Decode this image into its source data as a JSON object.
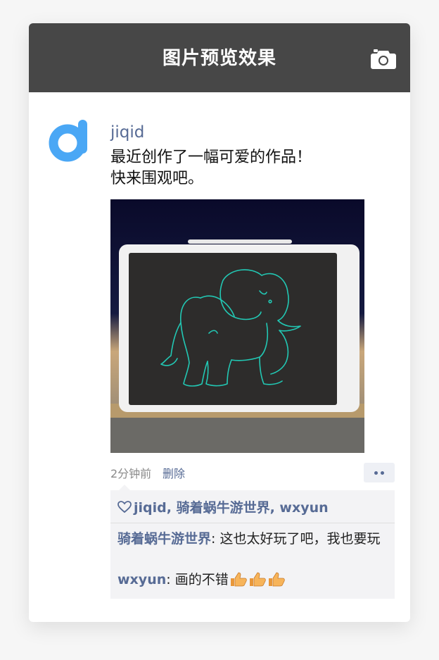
{
  "header": {
    "title": "图片预览效果",
    "camera_icon": "camera-icon"
  },
  "post": {
    "username": "jiqid",
    "text": "最近创作了一幅可爱的作品！\n快来围观吧。",
    "time": "2分钟前",
    "delete_label": "删除",
    "more_icon": "more-dots-icon"
  },
  "likes": {
    "text": "jiqid, 骑着蜗牛游世界, wxyun",
    "icon": "heart-icon"
  },
  "comments": [
    {
      "user": "骑着蜗牛游世界",
      "sep": ": ",
      "text": "这也太好玩了吧，我也要玩"
    },
    {
      "user": "wxyun",
      "sep": ": ",
      "text": "画的不错",
      "emoji": [
        "thumbs-up-icon",
        "thumbs-up-icon",
        "thumbs-up-icon"
      ]
    }
  ],
  "colors": {
    "header_bg": "#474747",
    "link": "#576b95",
    "accent_blue": "#4aa7f5",
    "drawing_line": "#22c8b4"
  }
}
